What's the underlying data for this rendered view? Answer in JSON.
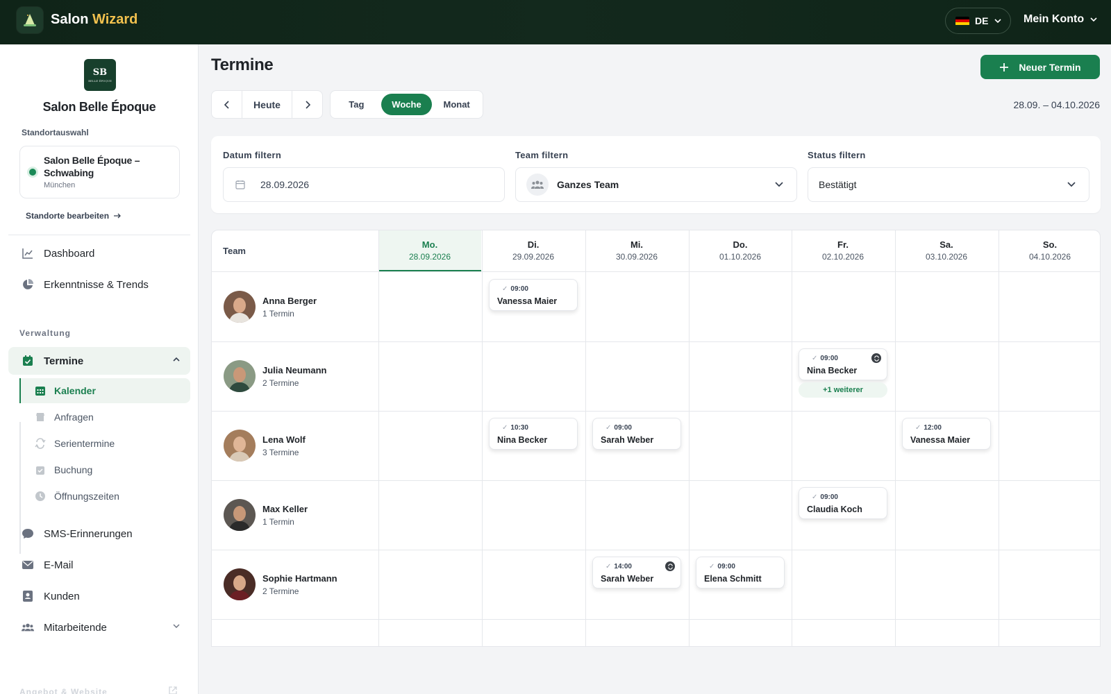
{
  "app": {
    "title_main": "Salon ",
    "title_accent": "Wizard"
  },
  "header": {
    "lang": "DE",
    "account": "Mein Konto"
  },
  "sidebar": {
    "logo_initials": "SB",
    "logo_small": "BELLE ÉPOQUE",
    "salon_name": "Salon Belle Époque",
    "location_label": "Standortauswahl",
    "location": {
      "name": "Salon Belle Époque – Schwabing",
      "city": "München"
    },
    "edit_locations": "Standorte bearbeiten",
    "nav_top": [
      {
        "label": "Dashboard",
        "icon": "chart-line-icon"
      },
      {
        "label": "Erkenntnisse & Trends",
        "icon": "pie-chart-icon"
      }
    ],
    "section_admin": "Verwaltung",
    "termine": {
      "label": "Termine"
    },
    "sub_items": [
      {
        "label": "Kalender"
      },
      {
        "label": "Anfragen"
      },
      {
        "label": "Serientermine"
      },
      {
        "label": "Buchung"
      },
      {
        "label": "Öffnungszeiten"
      }
    ],
    "nav_bottom": [
      {
        "label": "SMS-Erinnerungen"
      },
      {
        "label": "E-Mail"
      },
      {
        "label": "Kunden"
      },
      {
        "label": "Mitarbeitende"
      }
    ],
    "section_offer": "Angebot & Website"
  },
  "main": {
    "title": "Termine",
    "new_button": "Neuer Termin",
    "today": "Heute",
    "views": [
      "Tag",
      "Woche",
      "Monat"
    ],
    "active_view": "Woche",
    "date_range": "28.09. – 04.10.2026",
    "filters": {
      "date_label": "Datum filtern",
      "date_value": "28.09.2026",
      "team_label": "Team filtern",
      "team_value": "Ganzes Team",
      "status_label": "Status filtern",
      "status_value": "Bestätigt"
    }
  },
  "calendar": {
    "team_header": "Team",
    "days": [
      {
        "name": "Mo.",
        "date": "28.09.2026"
      },
      {
        "name": "Di.",
        "date": "29.09.2026"
      },
      {
        "name": "Mi.",
        "date": "30.09.2026"
      },
      {
        "name": "Do.",
        "date": "01.10.2026"
      },
      {
        "name": "Fr.",
        "date": "02.10.2026"
      },
      {
        "name": "Sa.",
        "date": "03.10.2026"
      },
      {
        "name": "So.",
        "date": "04.10.2026"
      }
    ],
    "members": [
      {
        "name": "Anna Berger",
        "count": "1 Termin"
      },
      {
        "name": "Julia Neumann",
        "count": "2 Termine"
      },
      {
        "name": "Lena Wolf",
        "count": "3 Termine"
      },
      {
        "name": "Max Keller",
        "count": "1 Termin"
      },
      {
        "name": "Sophie Hartmann",
        "count": "2 Termine"
      }
    ],
    "appointments": [
      {
        "time": "09:00",
        "client": "Vanessa Maier"
      },
      {
        "time": "09:00",
        "client": "Nina Becker"
      },
      {
        "time": "10:30",
        "client": "Nina Becker"
      },
      {
        "time": "09:00",
        "client": "Sarah Weber"
      },
      {
        "time": "12:00",
        "client": "Vanessa Maier"
      },
      {
        "time": "09:00",
        "client": "Claudia Koch"
      },
      {
        "time": "14:00",
        "client": "Sarah Weber"
      },
      {
        "time": "09:00",
        "client": "Elena Schmitt"
      }
    ],
    "more_label": "+1 weiterer"
  }
}
